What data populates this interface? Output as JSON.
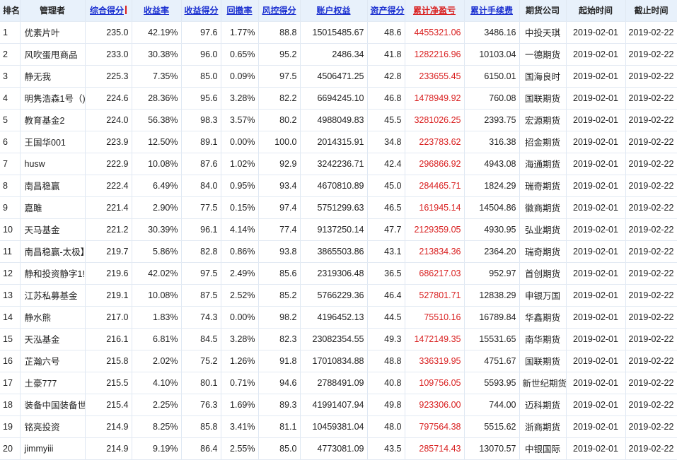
{
  "columns": [
    {
      "label": "排名",
      "link": false
    },
    {
      "label": "管理者",
      "link": false
    },
    {
      "label": "综合得分",
      "link": true,
      "sorted": true
    },
    {
      "label": "收益率",
      "link": true
    },
    {
      "label": "收益得分",
      "link": true
    },
    {
      "label": "回撤率",
      "link": true
    },
    {
      "label": "风控得分",
      "link": true
    },
    {
      "label": "账户权益",
      "link": true
    },
    {
      "label": "资产得分",
      "link": true
    },
    {
      "label": "累计净盈亏",
      "link": true,
      "red": true
    },
    {
      "label": "累计手续费",
      "link": true
    },
    {
      "label": "期货公司",
      "link": false
    },
    {
      "label": "起始时间",
      "link": false
    },
    {
      "label": "截止时间",
      "link": false
    }
  ],
  "rows": [
    [
      "1",
      "优素片叶",
      "235.0",
      "42.19%",
      "97.6",
      "1.77%",
      "88.8",
      "15015485.67",
      "48.6",
      "4455321.06",
      "3486.16",
      "中投天琪",
      "2019-02-01",
      "2019-02-22"
    ],
    [
      "2",
      "风吹蛋甩商品",
      "233.0",
      "30.38%",
      "96.0",
      "0.65%",
      "95.2",
      "2486.34",
      "41.8",
      "1282216.96",
      "10103.04",
      "一德期货",
      "2019-02-01",
      "2019-02-22"
    ],
    [
      "3",
      "静无我",
      "225.3",
      "7.35%",
      "85.0",
      "0.09%",
      "97.5",
      "4506471.25",
      "42.8",
      "233655.45",
      "6150.01",
      "国海良时",
      "2019-02-01",
      "2019-02-22"
    ],
    [
      "4",
      "明隽浩森1号（)",
      "224.6",
      "28.36%",
      "95.6",
      "3.28%",
      "82.2",
      "6694245.10",
      "46.8",
      "1478949.92",
      "760.08",
      "国联期货",
      "2019-02-01",
      "2019-02-22"
    ],
    [
      "5",
      "教育基金2",
      "224.0",
      "56.38%",
      "98.3",
      "3.57%",
      "80.2",
      "4988049.83",
      "45.5",
      "3281026.25",
      "2393.75",
      "宏源期货",
      "2019-02-01",
      "2019-02-22"
    ],
    [
      "6",
      "王国华001",
      "223.9",
      "12.50%",
      "89.1",
      "0.00%",
      "100.0",
      "2014315.91",
      "34.8",
      "223783.62",
      "316.38",
      "招金期货",
      "2019-02-01",
      "2019-02-22"
    ],
    [
      "7",
      "husw",
      "222.9",
      "10.08%",
      "87.6",
      "1.02%",
      "92.9",
      "3242236.71",
      "42.4",
      "296866.92",
      "4943.08",
      "海通期货",
      "2019-02-01",
      "2019-02-22"
    ],
    [
      "8",
      "南昌稳赢",
      "222.4",
      "6.49%",
      "84.0",
      "0.95%",
      "93.4",
      "4670810.89",
      "45.0",
      "284465.71",
      "1824.29",
      "瑞奇期货",
      "2019-02-01",
      "2019-02-22"
    ],
    [
      "9",
      "嘉雎",
      "221.4",
      "2.90%",
      "77.5",
      "0.15%",
      "97.4",
      "5751299.63",
      "46.5",
      "161945.14",
      "14504.86",
      "徽商期货",
      "2019-02-01",
      "2019-02-22"
    ],
    [
      "10",
      "天马基金",
      "221.2",
      "30.39%",
      "96.1",
      "4.14%",
      "77.4",
      "9137250.14",
      "47.7",
      "2129359.05",
      "4930.95",
      "弘业期货",
      "2019-02-01",
      "2019-02-22"
    ],
    [
      "11",
      "南昌稳赢-太极】",
      "219.7",
      "5.86%",
      "82.8",
      "0.86%",
      "93.8",
      "3865503.86",
      "43.1",
      "213834.36",
      "2364.20",
      "瑞奇期货",
      "2019-02-01",
      "2019-02-22"
    ],
    [
      "12",
      "静和投资静字1!",
      "219.6",
      "42.02%",
      "97.5",
      "2.49%",
      "85.6",
      "2319306.48",
      "36.5",
      "686217.03",
      "952.97",
      "首创期货",
      "2019-02-01",
      "2019-02-22"
    ],
    [
      "13",
      "江苏私募基金",
      "219.1",
      "10.08%",
      "87.5",
      "2.52%",
      "85.2",
      "5766229.36",
      "46.4",
      "527801.71",
      "12838.29",
      "申银万国",
      "2019-02-01",
      "2019-02-22"
    ],
    [
      "14",
      "静水熊",
      "217.0",
      "1.83%",
      "74.3",
      "0.00%",
      "98.2",
      "4196452.13",
      "44.5",
      "75510.16",
      "16789.84",
      "华鑫期货",
      "2019-02-01",
      "2019-02-22"
    ],
    [
      "15",
      "天泓基金",
      "216.1",
      "6.81%",
      "84.5",
      "3.28%",
      "82.3",
      "23082354.55",
      "49.3",
      "1472149.35",
      "15531.65",
      "南华期货",
      "2019-02-01",
      "2019-02-22"
    ],
    [
      "16",
      "芷瀚六号",
      "215.8",
      "2.02%",
      "75.2",
      "1.26%",
      "91.8",
      "17010834.88",
      "48.8",
      "336319.95",
      "4751.67",
      "国联期货",
      "2019-02-01",
      "2019-02-22"
    ],
    [
      "17",
      "土豪777",
      "215.5",
      "4.10%",
      "80.1",
      "0.71%",
      "94.6",
      "2788491.09",
      "40.8",
      "109756.05",
      "5593.95",
      "新世纪期货",
      "2019-02-01",
      "2019-02-22"
    ],
    [
      "18",
      "装备中国装备世",
      "215.4",
      "2.25%",
      "76.3",
      "1.69%",
      "89.3",
      "41991407.94",
      "49.8",
      "923306.00",
      "744.00",
      "迈科期货",
      "2019-02-01",
      "2019-02-22"
    ],
    [
      "19",
      "铭亮投资",
      "214.9",
      "8.25%",
      "85.8",
      "3.41%",
      "81.1",
      "10459381.04",
      "48.0",
      "797564.38",
      "5515.62",
      "浙商期货",
      "2019-02-01",
      "2019-02-22"
    ],
    [
      "20",
      "jimmyiii",
      "214.9",
      "9.19%",
      "86.4",
      "2.55%",
      "85.0",
      "4773081.09",
      "43.5",
      "285714.43",
      "13070.57",
      "中银国际",
      "2019-02-01",
      "2019-02-22"
    ]
  ]
}
